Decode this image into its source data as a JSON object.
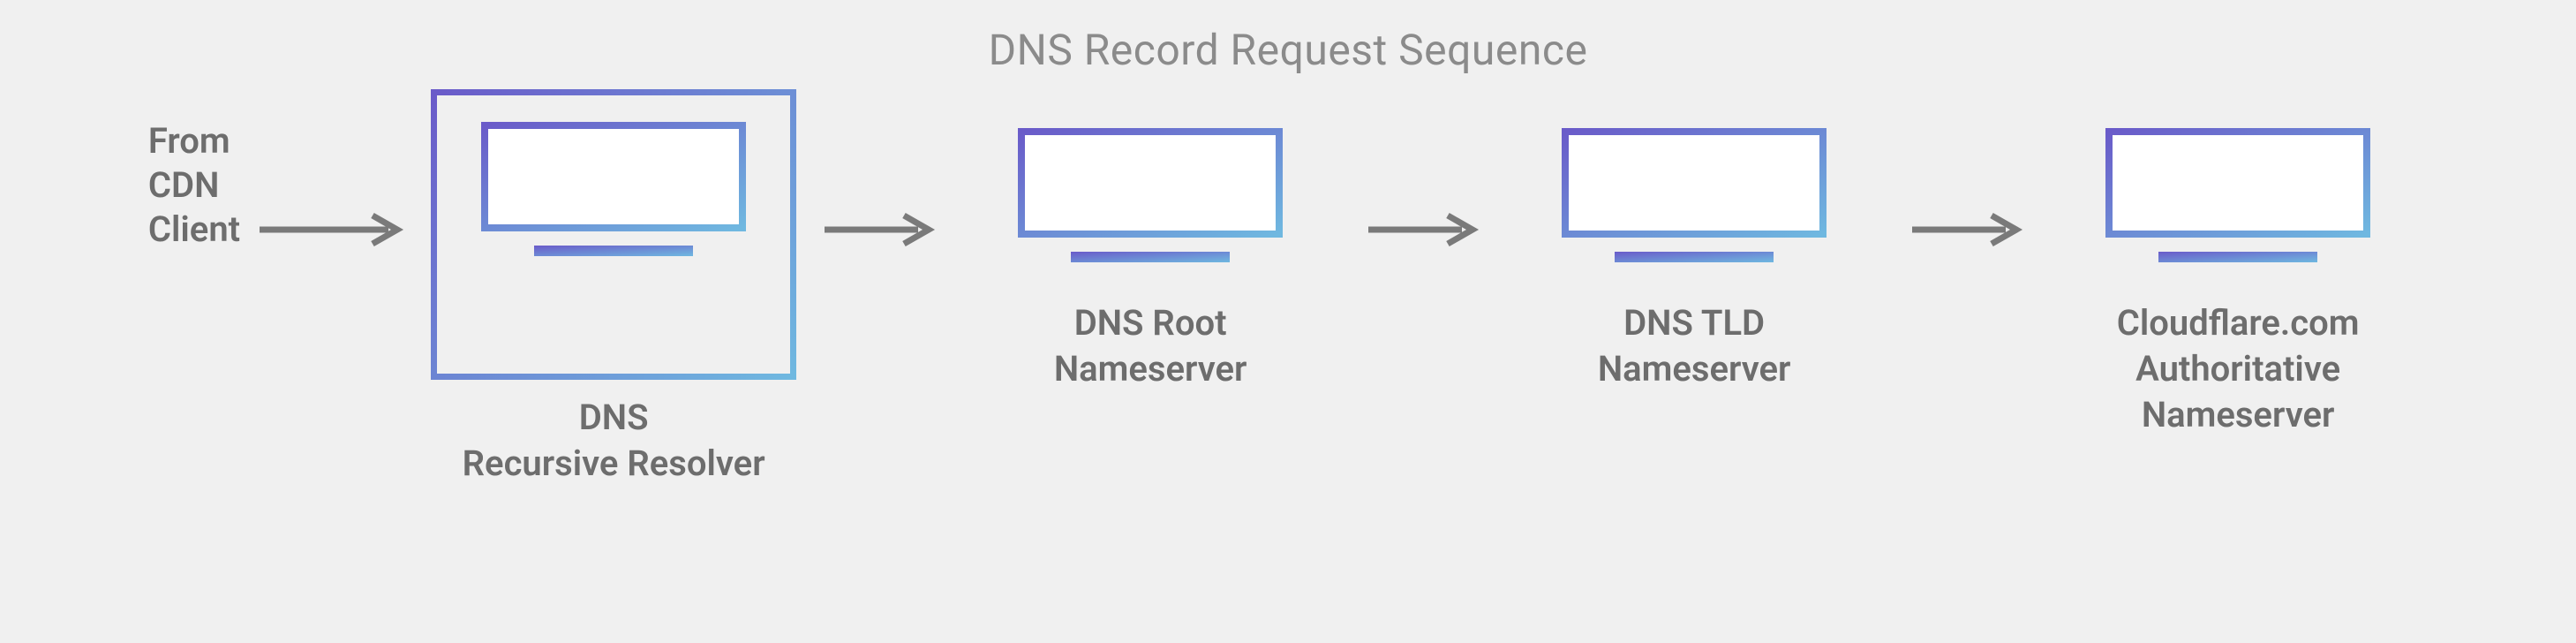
{
  "title": "DNS Record Request Sequence",
  "source": "From\nCDN\nClient",
  "nodes": [
    {
      "label": "DNS\nRecursive Resolver",
      "highlighted": true
    },
    {
      "label": "DNS Root\nNameserver",
      "highlighted": false
    },
    {
      "label": "DNS TLD\nNameserver",
      "highlighted": false
    },
    {
      "label": "Cloudflare.com\nAuthoritative\nNameserver",
      "highlighted": false
    }
  ],
  "colors": {
    "grad_start": "#6a5bc9",
    "grad_end": "#6fb8e0",
    "arrow": "#7a7a7a",
    "label": "#6d6d6d",
    "title": "#8b8b8b"
  }
}
